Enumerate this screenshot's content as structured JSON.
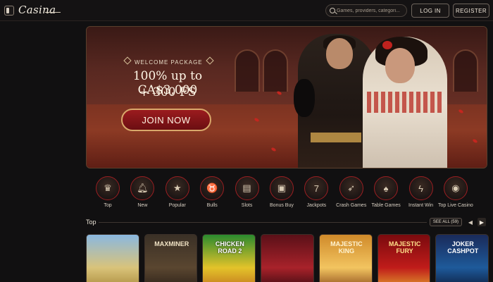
{
  "header": {
    "logo": "Casina",
    "search_placeholder": "Games, providers, categori...",
    "login_label": "LOG IN",
    "register_label": "REGISTER"
  },
  "hero": {
    "tag": "WELCOME PACKAGE",
    "title_line1": "100% up to CA$3,000",
    "title_line2": "+ 300 FS",
    "cta_label": "JOIN NOW"
  },
  "categories": [
    {
      "label": "Top",
      "icon": "crown-icon"
    },
    {
      "label": "New",
      "icon": "bell-icon"
    },
    {
      "label": "Popular",
      "icon": "star-icon"
    },
    {
      "label": "Bulls",
      "icon": "bull-icon"
    },
    {
      "label": "Slots",
      "icon": "slot-machine-icon"
    },
    {
      "label": "Bonus Buy",
      "icon": "gift-icon"
    },
    {
      "label": "Jackpots",
      "icon": "seven-icon"
    },
    {
      "label": "Crash Games",
      "icon": "rocket-icon"
    },
    {
      "label": "Table Games",
      "icon": "cards-icon"
    },
    {
      "label": "Instant Win",
      "icon": "lightning-icon"
    },
    {
      "label": "Top Live Casino",
      "icon": "roulette-icon"
    }
  ],
  "top_section": {
    "title": "Top",
    "see_all_label": "SEE ALL (59)",
    "games": [
      {
        "title": ""
      },
      {
        "title": "MAXMINER"
      },
      {
        "title": "CHICKEN ROAD 2"
      },
      {
        "title": ""
      },
      {
        "title": "MAJESTIC KING"
      },
      {
        "title": "MAJESTIC FURY"
      },
      {
        "title": "JOKER CASHPOT"
      }
    ]
  }
}
